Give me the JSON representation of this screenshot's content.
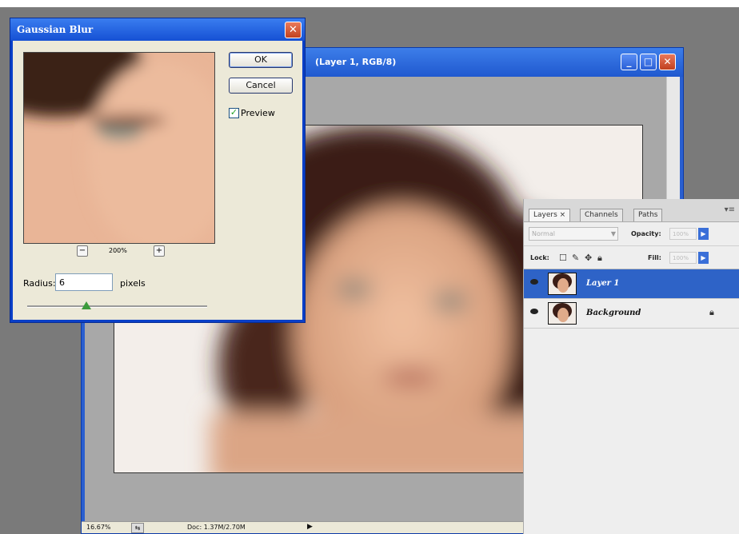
{
  "document_window": {
    "title": "(Layer 1, RGB/8)",
    "status": {
      "zoom": "16.67%",
      "doc_info": "Doc: 1.37M/2.70M"
    }
  },
  "dialog": {
    "title": "Gaussian Blur",
    "ok_label": "OK",
    "cancel_label": "Cancel",
    "preview_label": "Preview",
    "preview_checked": true,
    "zoom_level": "200%",
    "radius_label": "Radius:",
    "radius_value": "6",
    "radius_unit": "pixels",
    "radius_slider_fraction": 0.33
  },
  "layers_panel": {
    "tabs": [
      {
        "label": "Layers ×",
        "active": true
      },
      {
        "label": "Channels",
        "active": false
      },
      {
        "label": "Paths",
        "active": false
      }
    ],
    "blend_mode": "Normal",
    "opacity_label": "Opacity:",
    "opacity_value": "100%",
    "lock_label": "Lock:",
    "fill_label": "Fill:",
    "fill_value": "100%",
    "layers": [
      {
        "name": "Layer 1",
        "selected": true,
        "locked": false
      },
      {
        "name": "Background",
        "selected": false,
        "locked": true
      }
    ]
  },
  "icons": [
    "minimize-icon",
    "maximize-icon",
    "close-icon",
    "eye-icon",
    "lock-icon",
    "zoom-in-icon",
    "zoom-out-icon",
    "checkbox-icon"
  ],
  "colors": {
    "titlebar": "#1f58cf",
    "dialog_face": "#ece9d8",
    "selection": "#2e63c7",
    "close_button": "#c2411f"
  }
}
